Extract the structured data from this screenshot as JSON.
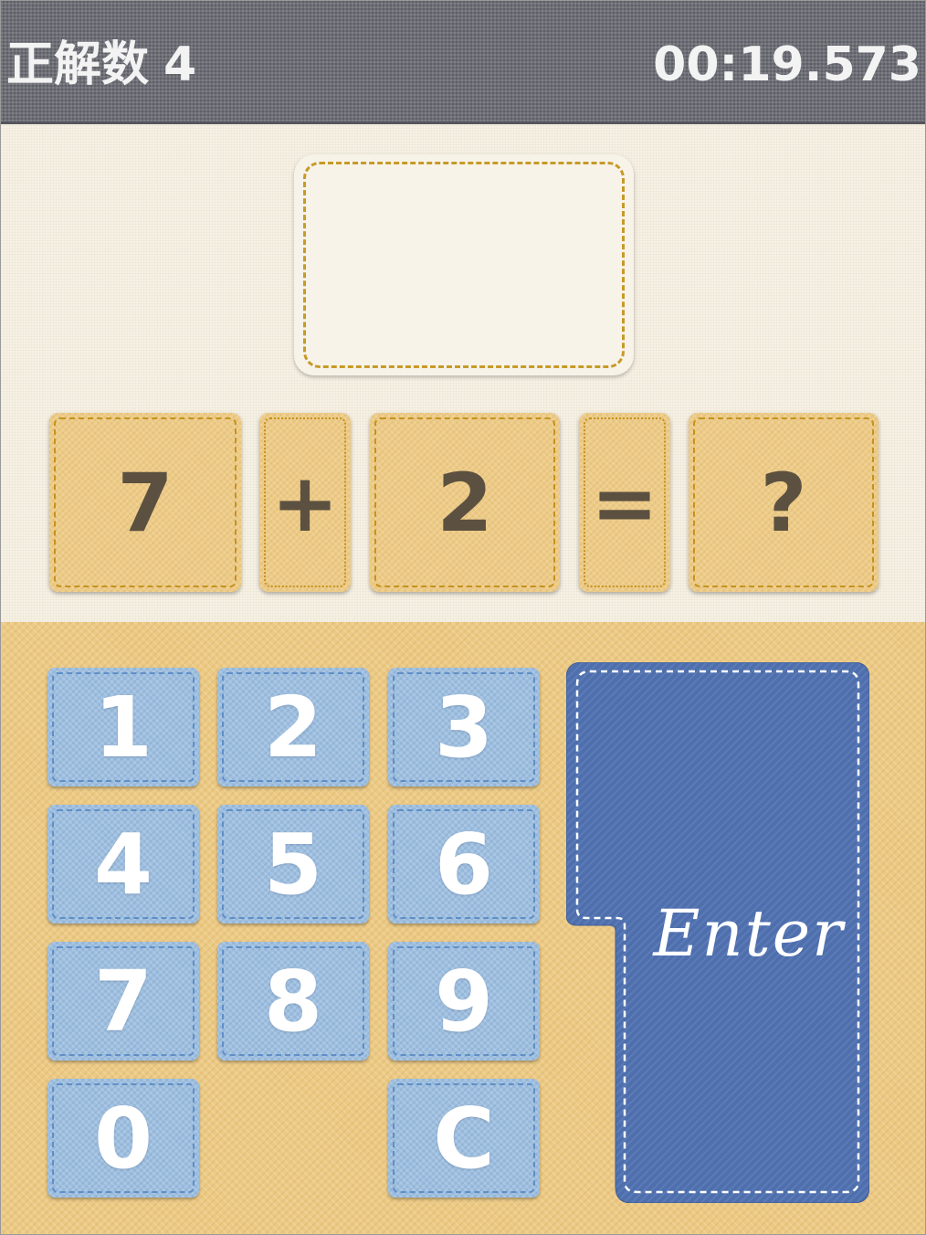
{
  "header": {
    "score_label": "正解数",
    "score_value": "4",
    "timer": "00:19.573"
  },
  "question": {
    "answer": "",
    "tiles": [
      "7",
      "+",
      "2",
      "=",
      "?"
    ]
  },
  "keypad": {
    "k1": "1",
    "k2": "2",
    "k3": "3",
    "k4": "4",
    "k5": "5",
    "k6": "6",
    "k7": "7",
    "k8": "8",
    "k9": "9",
    "k0": "0",
    "clear": "C",
    "enter": "Enter"
  },
  "colors": {
    "header_bg": "#6c6d75",
    "tile_bg": "#eecb86",
    "key_bg": "#9ebfe0",
    "enter_bg": "#4e6eac",
    "keypad_bg": "#ecca84"
  }
}
